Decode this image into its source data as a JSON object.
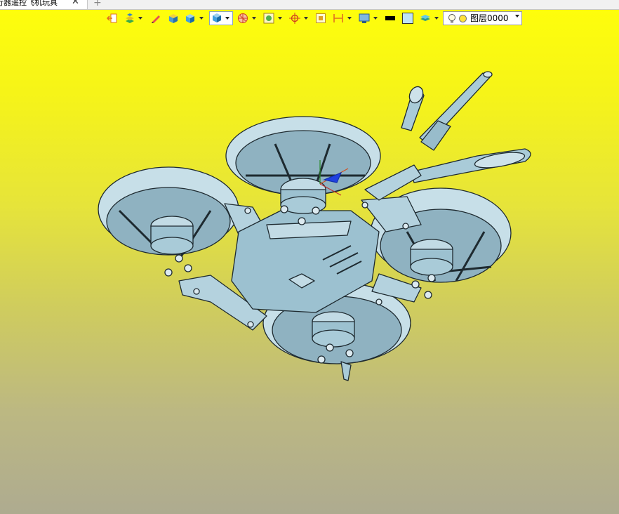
{
  "tabs": [
    {
      "label": "行器遥控飞机玩具",
      "active": true
    }
  ],
  "tab_close_symbol": "✕",
  "tab_add_symbol": "+",
  "toolbar": {
    "icons": [
      "exit-icon",
      "shading-mode-icon",
      "pencil-icon",
      "solid-box-icon",
      "view-cube-icon",
      "render-style-icon",
      "section-icon",
      "display-filter-icon",
      "snap-target-icon",
      "fit-view-icon",
      "dimension-icon",
      "monitor-icon",
      "line-color-icon",
      "face-color-icon",
      "layer-stack-icon"
    ],
    "layer": {
      "name": "图层0000",
      "color": "#ffe23a"
    }
  },
  "viewport": {
    "background_top": "#ffff0a",
    "background_bottom": "#aeab90",
    "model_color": "#a9cbd8",
    "model_edge_color": "#1e2a30"
  }
}
